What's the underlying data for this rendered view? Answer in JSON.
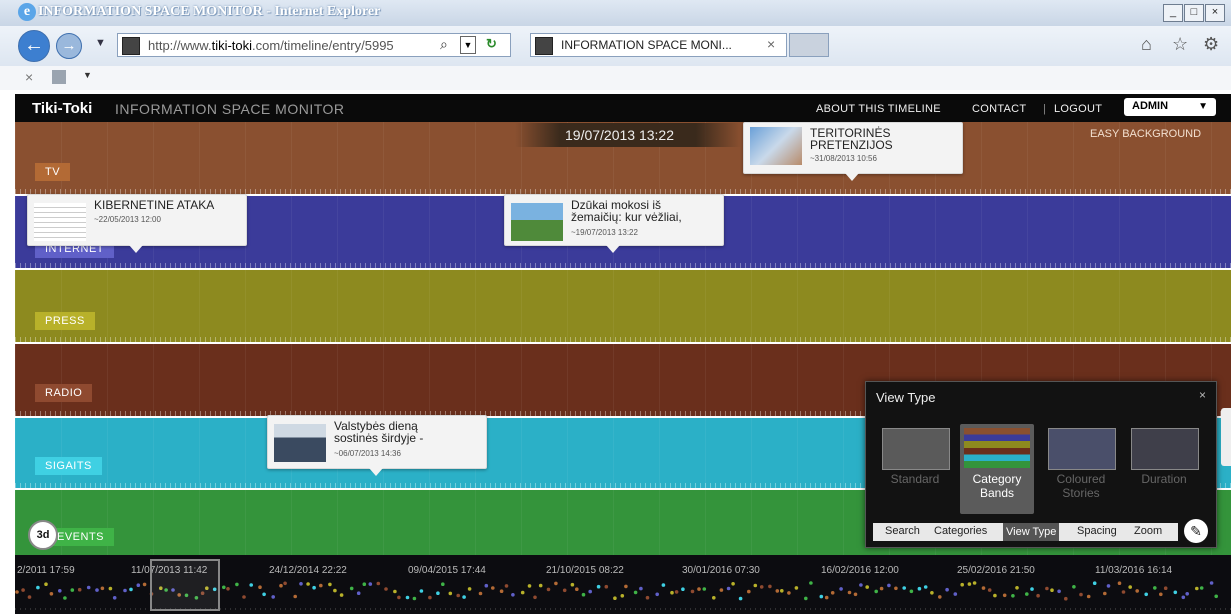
{
  "browser": {
    "window_title": "INFORMATION SPACE MONITOR - Internet Explorer",
    "url_prefix": "http://www.",
    "url_host": "tiki-toki",
    "url_rest": ".com/timeline/entry/5995",
    "tab_title": "INFORMATION SPACE MONI...",
    "tab_close": "×",
    "window_buttons": [
      "_",
      "□",
      "×"
    ]
  },
  "app": {
    "brand": "Tiki-Toki",
    "title": "INFORMATION SPACE MONITOR",
    "nav": [
      "ABOUT THIS TIMELINE",
      "CONTACT",
      "LOGOUT"
    ],
    "separator": "|",
    "user_menu": "ADMIN",
    "easy_background": "EASY BACKGROUND",
    "current_date": "19/07/2013 13:22",
    "mode_badge": "3d"
  },
  "categories": [
    {
      "label": "TV",
      "band_color": "#8a5030",
      "tag_color": "#b36a35"
    },
    {
      "label": "INTERNET",
      "band_color": "#3b3b9a",
      "tag_color": "#6060c8"
    },
    {
      "label": "PRESS",
      "band_color": "#8d8a1f",
      "tag_color": "#b8b12a"
    },
    {
      "label": "RADIO",
      "band_color": "#6a2f1c",
      "tag_color": "#8f4a30"
    },
    {
      "label": "SIGAITS",
      "band_color": "#2bb0c7",
      "tag_color": "#3fd0e3"
    },
    {
      "label": "EVENTS",
      "band_color": "#34943b",
      "tag_color": "#3fb347"
    }
  ],
  "stories": [
    {
      "title": "TERITORINĖS PRETENZIJOS",
      "date": "~31/08/2013 10:56"
    },
    {
      "title": "KIBERNETINE ATAKA",
      "date": "~22/05/2013 12:00"
    },
    {
      "title": "Dzūkai mokosi iš žemaičių: kur vėžliai,",
      "date": "~19/07/2013 13:22"
    },
    {
      "title": "Valstybės dieną sostinės širdyje -",
      "date": "~06/07/2013 14:36"
    }
  ],
  "view_type": {
    "title": "View Type",
    "close": "×",
    "options": [
      {
        "label": "Standard",
        "selected": false
      },
      {
        "label": "Category Bands",
        "selected": true
      },
      {
        "label": "Coloured Stories",
        "selected": false
      },
      {
        "label": "Duration",
        "selected": false
      }
    ],
    "tabs": [
      "Search",
      "Categories",
      "View Type",
      "Spacing",
      "Zoom"
    ],
    "active_tab": "View Type"
  },
  "mini_timeline": {
    "dates": [
      "2/2011 17:59",
      "11/07/2013 11:42",
      "24/12/2014 22:22",
      "09/04/2015 17:44",
      "21/10/2015 08:22",
      "30/01/2016 07:30",
      "16/02/2016 12:00",
      "25/02/2016 21:50",
      "11/03/2016 16:14"
    ]
  }
}
